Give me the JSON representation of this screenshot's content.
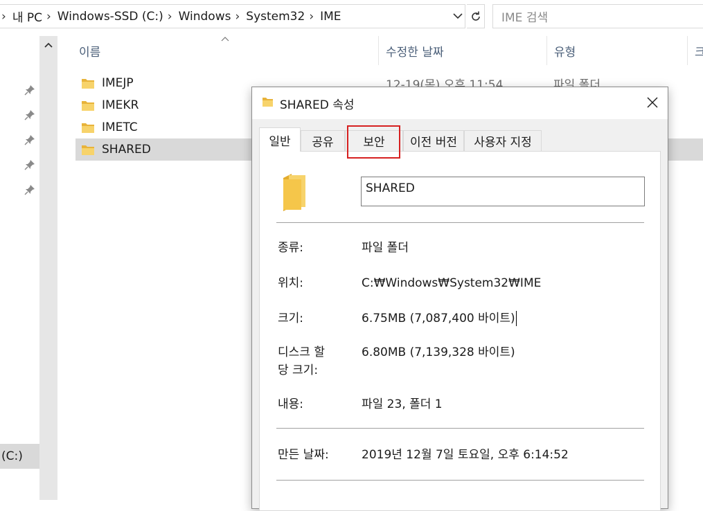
{
  "address": {
    "crumbs": [
      "내 PC",
      "Windows-SSD (C:)",
      "Windows",
      "System32",
      "IME"
    ],
    "search_placeholder": "IME 검색"
  },
  "nav": {
    "drive_label": "(C:)"
  },
  "columns": {
    "name": "이름",
    "date": "수정한 날짜",
    "type": "유형",
    "size": "크"
  },
  "files": [
    {
      "name": "IMEJP",
      "date": "12-19(목) 오후 11:54",
      "type": "파일 폴더"
    },
    {
      "name": "IMEKR",
      "date": "",
      "type": ""
    },
    {
      "name": "IMETC",
      "date": "",
      "type": ""
    },
    {
      "name": "SHARED",
      "date": "",
      "type": ""
    }
  ],
  "dialog": {
    "title": "SHARED 속성",
    "tabs": [
      "일반",
      "공유",
      "보안",
      "이전 버전",
      "사용자 지정"
    ],
    "active_tab": "일반",
    "highlighted_tab": "보안",
    "folder_name": "SHARED",
    "properties": {
      "type_label": "종류:",
      "type_value": "파일 폴더",
      "location_label": "위치:",
      "location_value": "C:₩Windows₩System32₩IME",
      "size_label": "크기:",
      "size_value": "6.75MB (7,087,400 바이트)",
      "disk_size_label_1": "디스크 할",
      "disk_size_label_2": "당 크기:",
      "disk_size_value": "6.80MB (7,139,328 바이트)",
      "contents_label": "내용:",
      "contents_value": "파일 23, 폴더 1",
      "created_label": "만든 날짜:",
      "created_value": "2019년 12월 7일 토요일, 오후 6:14:52"
    }
  },
  "colors": {
    "highlight_box": "#d62020",
    "folder_yellow": "#f5c64a",
    "selected_row": "#d9d9d9",
    "header_text": "#4c607a"
  }
}
